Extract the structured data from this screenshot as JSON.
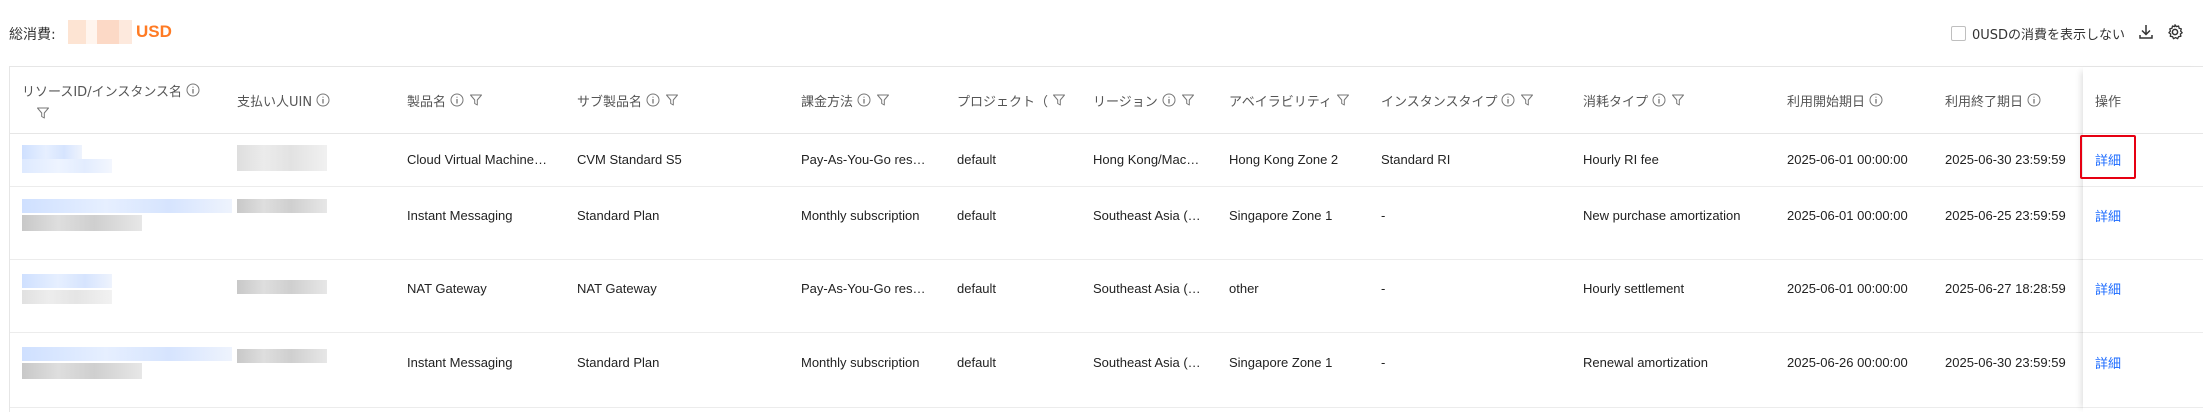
{
  "summary": {
    "total_label": "総消費:",
    "currency": "USD",
    "hide_zero_label": "0USDの消費を表示しない",
    "hide_zero_checked": false,
    "accent_color": "#ff7b24"
  },
  "toolbar": {
    "icons": [
      "download-icon",
      "settings-icon"
    ]
  },
  "table": {
    "columns": {
      "resource_id": "リソースID/インスタンス名",
      "payer_uin": "支払い人UIN",
      "product": "製品名",
      "sub_product": "サブ製品名",
      "billing_mode": "課金方法",
      "project": "プロジェクト（",
      "region": "リージョン",
      "zone": "アベイラビリティ",
      "instance_type": "インスタンスタイプ",
      "consumption_type": "消耗タイプ",
      "start_date": "利用開始期日",
      "end_date": "利用終了期日",
      "actions": "操作"
    },
    "rows": [
      {
        "product": "Cloud Virtual Machine…",
        "sub_product": "CVM Standard S5",
        "billing_mode": "Pay-As-You-Go res…",
        "project": "default",
        "region": "Hong Kong/Mac…",
        "zone": "Hong Kong Zone 2",
        "instance_type": "Standard RI",
        "consumption_type": "Hourly RI fee",
        "start_date": "2025-06-01 00:00:00",
        "end_date": "2025-06-30 23:59:59",
        "action": "詳細"
      },
      {
        "product": "Instant Messaging",
        "sub_product": "Standard Plan",
        "billing_mode": "Monthly subscription",
        "project": "default",
        "region": "Southeast Asia (…",
        "zone": "Singapore Zone 1",
        "instance_type": "-",
        "consumption_type": "New purchase amortization",
        "start_date": "2025-06-01 00:00:00",
        "end_date": "2025-06-25 23:59:59",
        "action": "詳細"
      },
      {
        "product": "NAT Gateway",
        "sub_product": "NAT Gateway",
        "billing_mode": "Pay-As-You-Go res…",
        "project": "default",
        "region": "Southeast Asia (…",
        "zone": "other",
        "instance_type": "-",
        "consumption_type": "Hourly settlement",
        "start_date": "2025-06-01 00:00:00",
        "end_date": "2025-06-27 18:28:59",
        "action": "詳細"
      },
      {
        "product": "Instant Messaging",
        "sub_product": "Standard Plan",
        "billing_mode": "Monthly subscription",
        "project": "default",
        "region": "Southeast Asia (…",
        "zone": "Singapore Zone 1",
        "instance_type": "-",
        "consumption_type": "Renewal amortization",
        "start_date": "2025-06-26 00:00:00",
        "end_date": "2025-06-30 23:59:59",
        "action": "詳細"
      }
    ]
  }
}
